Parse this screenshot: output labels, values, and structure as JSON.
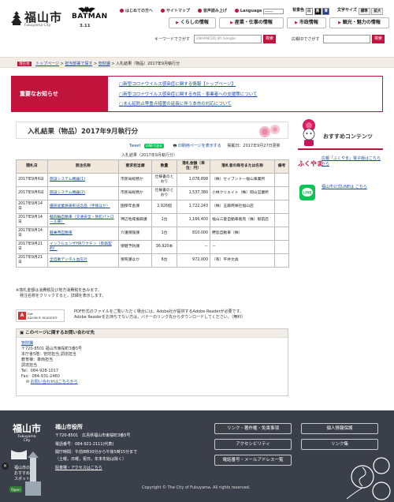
{
  "header": {
    "logo_name": "福山市",
    "logo_sub": "Fukuyama City",
    "batman_title": "BATMAN",
    "batman_date": "3.11",
    "util_links": [
      "はじめての方へ",
      "サイトマップ",
      "音声読み上げ",
      "Language"
    ],
    "language_select": "------",
    "color_label": "背景色",
    "color_options": [
      "白",
      "黒",
      "青"
    ],
    "size_label": "文字サイズ",
    "size_options": [
      "標準",
      "拡大"
    ],
    "nav": [
      "くらしの情報",
      "産業・仕事の情報",
      "市政情報",
      "観光・魅力の情報"
    ],
    "keyword_label": "キーワードでさがす",
    "keyword_placeholder": "ENHANCED BY Google",
    "search_button": "検索",
    "ad_label": "広報IDでさがす",
    "ad_search_button": "検索"
  },
  "breadcrumb": {
    "here_label": "現在地",
    "items": [
      "トップページ",
      "担当部署で探す",
      "管財課"
    ],
    "current": "入札結果（物品）2017年9月執行分"
  },
  "notice": {
    "heading": "重要なお知らせ",
    "items": [
      "新型コロナウイルス感染症に関する情報【トップページ】",
      "新型コロナウイルス感染症に関する市民・事業者への支援策について",
      "まん延防止等重点措置の延長に伴う本市の対応について"
    ]
  },
  "main": {
    "title": "入札結果（物品）2017年9月執行分",
    "tweet": "Tweet",
    "line_button": "LINEで送る",
    "print_link": "印刷用ページを表示する",
    "published": "掲載日：2017年9月27日更新",
    "table_caption": "入札結果（2017年9月執行分）",
    "columns": [
      "開札日",
      "発注名称",
      "要求担当課",
      "数量",
      "落札金額（単位：円）",
      "落札者の商号または名称",
      "備考"
    ],
    "rows": [
      [
        "2017年9月6日",
        "施設システム機器(1)",
        "市民局総務か",
        "仕様書のとおり",
        "1,078,898",
        "（株）セイブンドー福山事業所",
        ""
      ],
      [
        "2017年9月6日",
        "施設システム機器(2)",
        "市民局総務か",
        "仕様書のとおり",
        "1,537,380",
        "小林クリエイト（株）岡山営業所",
        ""
      ],
      [
        "2017年9月14日",
        "優良従業員表彰記念品（手帳ほか）",
        "国保年金課",
        "2,926個",
        "1,722,243",
        "（株）五藤商栄社福山店",
        ""
      ],
      [
        "2017年9月14日",
        "軽四輪自動車（交通安全・防犯パトロール車）",
        "神辺地域振興課",
        "1台",
        "1,166,400",
        "福山三菱自動車販売（株）駅前店",
        ""
      ],
      [
        "2017年9月14日",
        "軽乗用自動車",
        "介護保険課",
        "1台",
        "810,000",
        "野島自動車（株）",
        ""
      ],
      [
        "2017年9月21日",
        "インフルエンザHAワクチン（単価契約）",
        "保健予防課",
        "36,920本",
        "－",
        "－",
        ""
      ],
      [
        "2017年9月21日",
        "全自動デジタル血圧計",
        "保育課ほか",
        "6台",
        "972,000",
        "（有）平井文具",
        ""
      ]
    ],
    "notes": [
      "※落札金額は消費税及び地方消費税を含みます。",
      "　発注名称をクリックすると，詳細を表示します。"
    ],
    "adobe_badge_top": "Get",
    "adobe_badge_bottom": "ADOBE® READER®",
    "adobe_msg": [
      "PDF形式のファイルをご覧いただく場合には，Adobe社が提供するAdobe Readerが必要です。",
      "Adobe Readerをお持ちでない方は，バナーのリンク先からダウンロードしてください。（無料）"
    ],
    "inquiry_title": "このページに関するお問い合わせ先",
    "inquiry_lines": [
      "管財課",
      "〒720-8501 福山市東桜町3番5号",
      "本庁舎5階：管財担当,調達担当",
      "教育棟：車両担当",
      "調達担当",
      "Tel：084-928-1017",
      "Fax：084-931-2460"
    ],
    "inquiry_link": "お問い合わせはこちらから"
  },
  "sidebar": {
    "title": "おすすめコンテンツ",
    "items": [
      {
        "text": "広報「ふくやま」電子版はこちらから",
        "icon": "fukuyama-pr-icon"
      },
      {
        "text": "福山市公式LINEは こちら",
        "icon": "line-icon"
      }
    ],
    "fukuyama_label": "ふくやま"
  },
  "footer": {
    "logo_name": "福山市",
    "logo_sub_1": "Fukuyama",
    "logo_sub_2": "City",
    "office": "福山市役所",
    "address": "〒720-8501　広島県福山市東桜町3番5号",
    "phone": "電話番号：084-921-2111(代表)",
    "hours": "開庁時間：午前8時30分から午後5時15分まで",
    "closed": "（土曜，日曜，祝日，年末年始は除く）",
    "access_link": "駐車場・アクセスはこちら",
    "buttons": [
      "リンク・著作権・免責事項",
      "個人情報保護",
      "アクセシビリティ",
      "リンク集",
      "電話番号・メールアドレス一覧"
    ],
    "copyright": "Copyright © The City of Fukuyama. All rights reserved.",
    "banner_label_1": "福山市の",
    "banner_label_2": "おすすめ",
    "banner_label_3": "スポット",
    "banner_open": "Open"
  },
  "colors": {
    "accent": "#c0143c",
    "footer_bg": "#3b3f49",
    "link": "#1a4fa0",
    "crumb_bg": "#f1ede6"
  }
}
